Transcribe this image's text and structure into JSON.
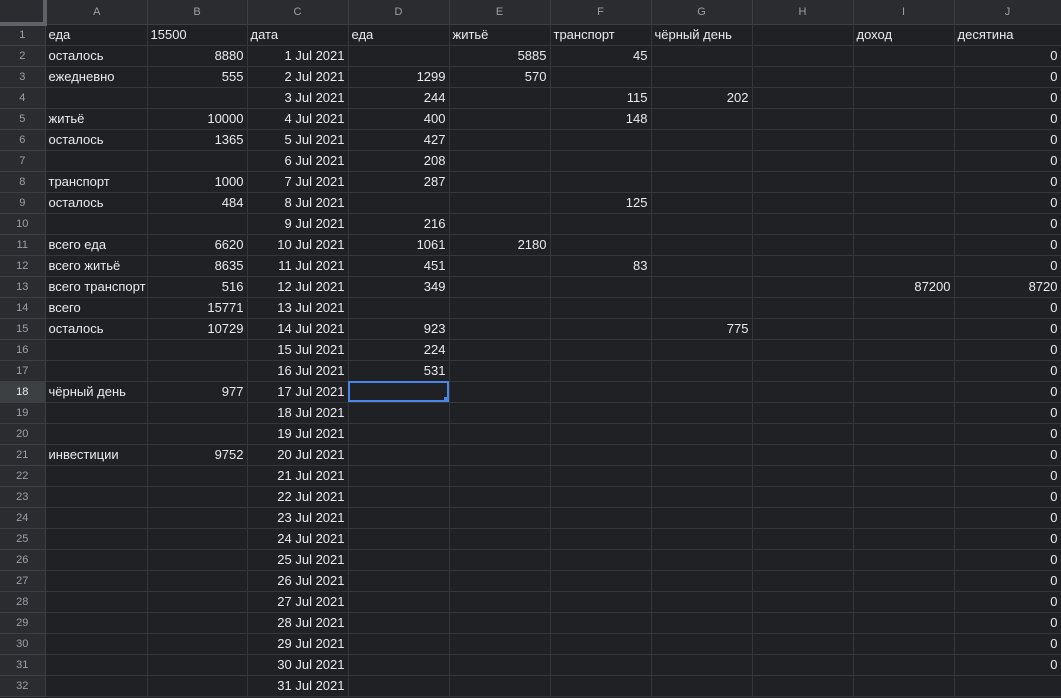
{
  "columns": [
    "A",
    "B",
    "C",
    "D",
    "E",
    "F",
    "G",
    "H",
    "I",
    "J"
  ],
  "selected_cell": "D18",
  "rows": [
    {
      "n": "1",
      "a": "еда",
      "b": "15500",
      "c": "дата",
      "d": "еда",
      "e": "житьё",
      "f": "транспорт",
      "g": "чёрный день",
      "h": "",
      "i": "доход",
      "j": "десятина"
    },
    {
      "n": "2",
      "a": "осталось",
      "b": "8880",
      "c": "1 Jul 2021",
      "d": "",
      "e": "5885",
      "f": "45",
      "g": "",
      "h": "",
      "i": "",
      "j": "0"
    },
    {
      "n": "3",
      "a": "ежедневно",
      "b": "555",
      "c": "2 Jul 2021",
      "d": "1299",
      "e": "570",
      "f": "",
      "g": "",
      "h": "",
      "i": "",
      "j": "0"
    },
    {
      "n": "4",
      "a": "",
      "b": "",
      "c": "3 Jul 2021",
      "d": "244",
      "e": "",
      "f": "115",
      "g": "202",
      "h": "",
      "i": "",
      "j": "0"
    },
    {
      "n": "5",
      "a": "житьё",
      "b": "10000",
      "c": "4 Jul 2021",
      "d": "400",
      "e": "",
      "f": "148",
      "g": "",
      "h": "",
      "i": "",
      "j": "0"
    },
    {
      "n": "6",
      "a": "осталось",
      "b": "1365",
      "c": "5 Jul 2021",
      "d": "427",
      "e": "",
      "f": "",
      "g": "",
      "h": "",
      "i": "",
      "j": "0"
    },
    {
      "n": "7",
      "a": "",
      "b": "",
      "c": "6 Jul 2021",
      "d": "208",
      "e": "",
      "f": "",
      "g": "",
      "h": "",
      "i": "",
      "j": "0"
    },
    {
      "n": "8",
      "a": "транспорт",
      "b": "1000",
      "c": "7 Jul 2021",
      "d": "287",
      "e": "",
      "f": "",
      "g": "",
      "h": "",
      "i": "",
      "j": "0"
    },
    {
      "n": "9",
      "a": "осталось",
      "b": "484",
      "c": "8 Jul 2021",
      "d": "",
      "e": "",
      "f": "125",
      "g": "",
      "h": "",
      "i": "",
      "j": "0"
    },
    {
      "n": "10",
      "a": "",
      "b": "",
      "c": "9 Jul 2021",
      "d": "216",
      "e": "",
      "f": "",
      "g": "",
      "h": "",
      "i": "",
      "j": "0"
    },
    {
      "n": "11",
      "a": "всего еда",
      "b": "6620",
      "c": "10 Jul 2021",
      "d": "1061",
      "e": "2180",
      "f": "",
      "g": "",
      "h": "",
      "i": "",
      "j": "0"
    },
    {
      "n": "12",
      "a": "всего житьё",
      "b": "8635",
      "c": "11 Jul 2021",
      "d": "451",
      "e": "",
      "f": "83",
      "g": "",
      "h": "",
      "i": "",
      "j": "0"
    },
    {
      "n": "13",
      "a": "всего транспорт",
      "b": "516",
      "c": "12 Jul 2021",
      "d": "349",
      "e": "",
      "f": "",
      "g": "",
      "h": "",
      "i": "87200",
      "j": "8720"
    },
    {
      "n": "14",
      "a": "всего",
      "b": "15771",
      "c": "13 Jul 2021",
      "d": "",
      "e": "",
      "f": "",
      "g": "",
      "h": "",
      "i": "",
      "j": "0"
    },
    {
      "n": "15",
      "a": "осталось",
      "b": "10729",
      "c": "14 Jul 2021",
      "d": "923",
      "e": "",
      "f": "",
      "g": "775",
      "h": "",
      "i": "",
      "j": "0"
    },
    {
      "n": "16",
      "a": "",
      "b": "",
      "c": "15 Jul 2021",
      "d": "224",
      "e": "",
      "f": "",
      "g": "",
      "h": "",
      "i": "",
      "j": "0"
    },
    {
      "n": "17",
      "a": "",
      "b": "",
      "c": "16 Jul 2021",
      "d": "531",
      "e": "",
      "f": "",
      "g": "",
      "h": "",
      "i": "",
      "j": "0"
    },
    {
      "n": "18",
      "a": "чёрный день",
      "b": "977",
      "c": "17 Jul 2021",
      "d": "",
      "e": "",
      "f": "",
      "g": "",
      "h": "",
      "i": "",
      "j": "0"
    },
    {
      "n": "19",
      "a": "",
      "b": "",
      "c": "18 Jul 2021",
      "d": "",
      "e": "",
      "f": "",
      "g": "",
      "h": "",
      "i": "",
      "j": "0"
    },
    {
      "n": "20",
      "a": "",
      "b": "",
      "c": "19 Jul 2021",
      "d": "",
      "e": "",
      "f": "",
      "g": "",
      "h": "",
      "i": "",
      "j": "0"
    },
    {
      "n": "21",
      "a": "инвестиции",
      "b": "9752",
      "c": "20 Jul 2021",
      "d": "",
      "e": "",
      "f": "",
      "g": "",
      "h": "",
      "i": "",
      "j": "0"
    },
    {
      "n": "22",
      "a": "",
      "b": "",
      "c": "21 Jul 2021",
      "d": "",
      "e": "",
      "f": "",
      "g": "",
      "h": "",
      "i": "",
      "j": "0"
    },
    {
      "n": "23",
      "a": "",
      "b": "",
      "c": "22 Jul 2021",
      "d": "",
      "e": "",
      "f": "",
      "g": "",
      "h": "",
      "i": "",
      "j": "0"
    },
    {
      "n": "24",
      "a": "",
      "b": "",
      "c": "23 Jul 2021",
      "d": "",
      "e": "",
      "f": "",
      "g": "",
      "h": "",
      "i": "",
      "j": "0"
    },
    {
      "n": "25",
      "a": "",
      "b": "",
      "c": "24 Jul 2021",
      "d": "",
      "e": "",
      "f": "",
      "g": "",
      "h": "",
      "i": "",
      "j": "0"
    },
    {
      "n": "26",
      "a": "",
      "b": "",
      "c": "25 Jul 2021",
      "d": "",
      "e": "",
      "f": "",
      "g": "",
      "h": "",
      "i": "",
      "j": "0"
    },
    {
      "n": "27",
      "a": "",
      "b": "",
      "c": "26 Jul 2021",
      "d": "",
      "e": "",
      "f": "",
      "g": "",
      "h": "",
      "i": "",
      "j": "0"
    },
    {
      "n": "28",
      "a": "",
      "b": "",
      "c": "27 Jul 2021",
      "d": "",
      "e": "",
      "f": "",
      "g": "",
      "h": "",
      "i": "",
      "j": "0"
    },
    {
      "n": "29",
      "a": "",
      "b": "",
      "c": "28 Jul 2021",
      "d": "",
      "e": "",
      "f": "",
      "g": "",
      "h": "",
      "i": "",
      "j": "0"
    },
    {
      "n": "30",
      "a": "",
      "b": "",
      "c": "29 Jul 2021",
      "d": "",
      "e": "",
      "f": "",
      "g": "",
      "h": "",
      "i": "",
      "j": "0"
    },
    {
      "n": "31",
      "a": "",
      "b": "",
      "c": "30 Jul 2021",
      "d": "",
      "e": "",
      "f": "",
      "g": "",
      "h": "",
      "i": "",
      "j": "0"
    },
    {
      "n": "32",
      "a": "",
      "b": "",
      "c": "31 Jul 2021",
      "d": "",
      "e": "",
      "f": "",
      "g": "",
      "h": "",
      "i": "",
      "j": ""
    }
  ],
  "colors": {
    "background": "#202124",
    "header_bg": "#2b2c2f",
    "grid": "#353638",
    "text": "#e8eaed",
    "selection": "#4a86e8"
  }
}
